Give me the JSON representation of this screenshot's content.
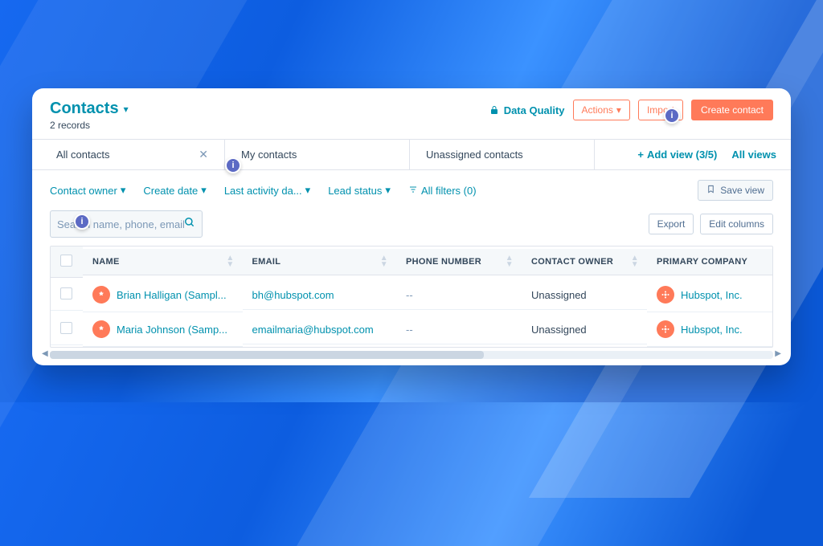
{
  "header": {
    "title": "Contacts",
    "record_count_label": "2 records",
    "data_quality_label": "Data Quality",
    "actions_label": "Actions",
    "import_label": "Import",
    "create_label": "Create contact"
  },
  "tabs": [
    {
      "label": "All contacts",
      "closable": true
    },
    {
      "label": "My contacts",
      "closable": false
    },
    {
      "label": "Unassigned contacts",
      "closable": false
    }
  ],
  "tabs_right": {
    "add_view_label": "Add view (3/5)",
    "all_views_label": "All views"
  },
  "filters": {
    "contact_owner": "Contact owner",
    "create_date": "Create date",
    "last_activity": "Last activity da...",
    "lead_status": "Lead status",
    "all_filters": "All filters (0)",
    "save_view": "Save view"
  },
  "search": {
    "placeholder": "Search name, phone, email"
  },
  "toolbar": {
    "export": "Export",
    "edit_columns": "Edit columns"
  },
  "columns": [
    "NAME",
    "EMAIL",
    "PHONE NUMBER",
    "CONTACT OWNER",
    "PRIMARY COMPANY"
  ],
  "rows": [
    {
      "name": "Brian Halligan (Sampl...",
      "email": "bh@hubspot.com",
      "phone": "--",
      "owner": "Unassigned",
      "company": "Hubspot, Inc."
    },
    {
      "name": "Maria Johnson (Samp...",
      "email": "emailmaria@hubspot.com",
      "phone": "--",
      "owner": "Unassigned",
      "company": "Hubspot, Inc."
    }
  ],
  "info_badge_glyph": "i"
}
